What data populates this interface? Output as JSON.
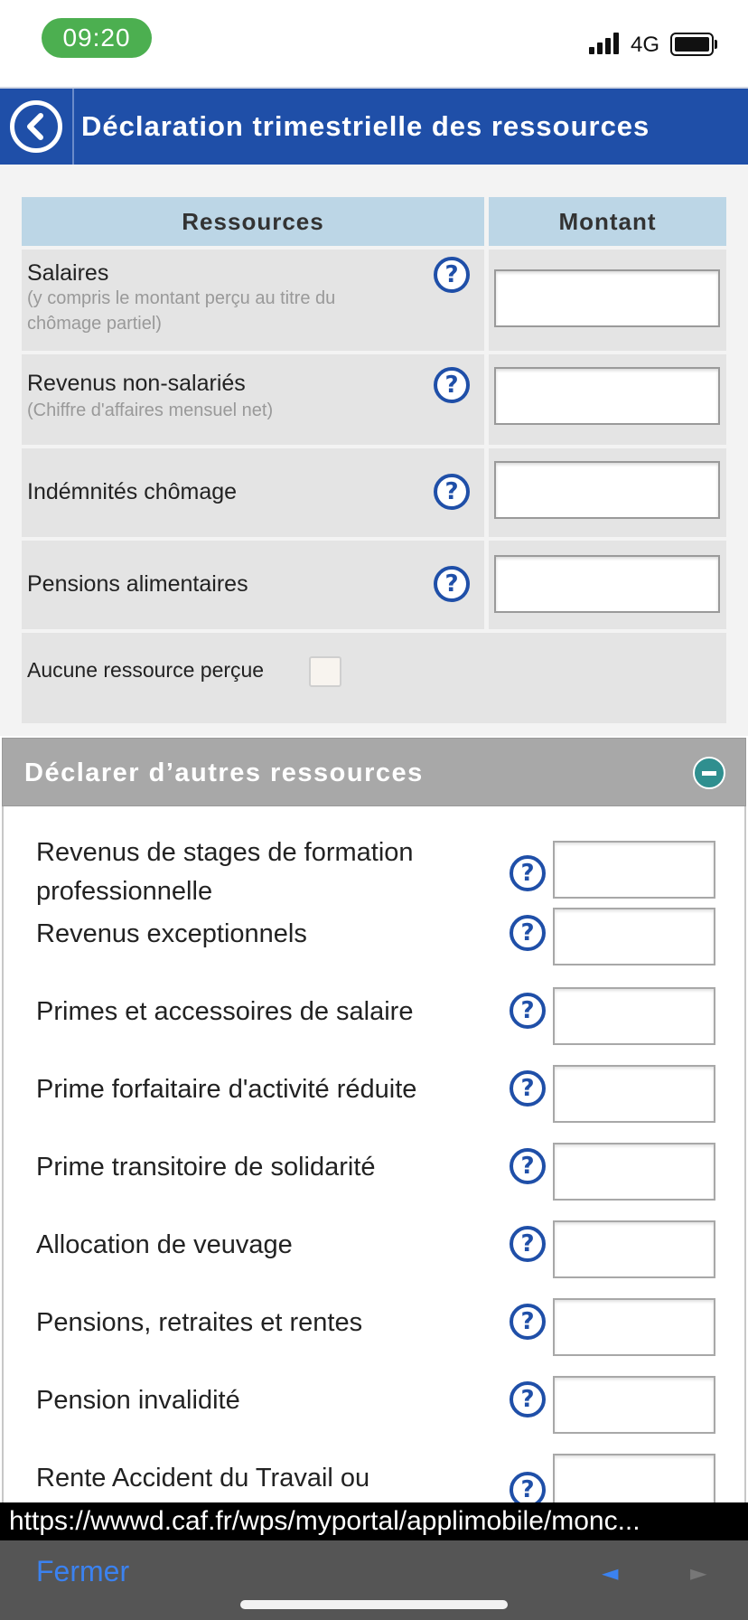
{
  "status_bar": {
    "time": "09:20",
    "network": "4G",
    "colors": {
      "time_pill": "#4caf50"
    }
  },
  "header": {
    "title": "Déclaration trimestrielle des ressources",
    "back_icon": "chevron-left-circle-icon",
    "color": "#1f4fa8"
  },
  "table": {
    "columns": [
      "Ressources",
      "Montant"
    ],
    "rows": [
      {
        "label": "Salaires",
        "sublabel": "(y compris le montant perçu au titre du chômage partiel)",
        "help": "?",
        "value": ""
      },
      {
        "label": "Revenus non-salariés",
        "sublabel": "(Chiffre d'affaires mensuel net)",
        "help": "?",
        "value": ""
      },
      {
        "label": "Indémnités chômage",
        "help": "?",
        "value": ""
      },
      {
        "label": "Pensions alimentaires",
        "help": "?",
        "value": ""
      }
    ],
    "none_label": "Aucune ressource perçue",
    "none_checked": false
  },
  "other": {
    "title": "Déclarer d’autres ressources",
    "toggle_icon": "minus-circle-icon",
    "rows": [
      {
        "label": "Revenus de stages de formation professionnelle",
        "help": "?",
        "value": ""
      },
      {
        "label": "Revenus exceptionnels",
        "help": "?",
        "value": ""
      },
      {
        "label": "Primes et accessoires de salaire",
        "help": "?",
        "value": ""
      },
      {
        "label": "Prime forfaitaire d'activité réduite",
        "help": "?",
        "value": ""
      },
      {
        "label": "Prime transitoire de solidarité",
        "help": "?",
        "value": ""
      },
      {
        "label": "Allocation de veuvage",
        "help": "?",
        "value": ""
      },
      {
        "label": "Pensions, retraites et rentes",
        "help": "?",
        "value": ""
      },
      {
        "label": "Pension invalidité",
        "help": "?",
        "value": ""
      },
      {
        "label": "Rente Accident du Travail ou",
        "help": "?",
        "value": ""
      }
    ]
  },
  "browser": {
    "url": "https://wwwd.caf.fr/wps/myportal/applimobile/monc...",
    "close_label": "Fermer",
    "back_glyph": "◄",
    "forward_glyph": "►"
  }
}
